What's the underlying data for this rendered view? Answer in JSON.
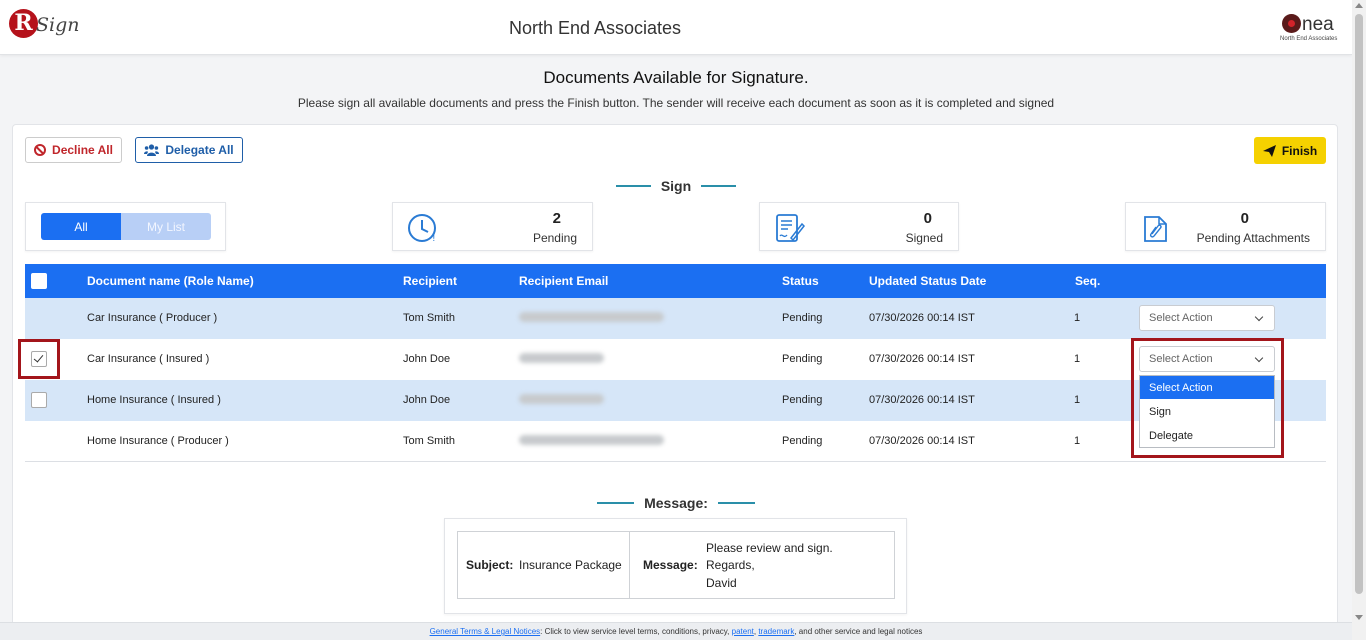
{
  "brand": {
    "logo_letter": "R",
    "logo_text": "Sign"
  },
  "header": {
    "company_name": "North End Associates",
    "partner_logo_word": "nea",
    "partner_logo_sub": "North End Associates"
  },
  "page": {
    "title": "Documents Available for Signature.",
    "subtitle": "Please sign all available documents and press the Finish button. The sender will receive each document as soon as it is completed and signed"
  },
  "toolbar": {
    "decline_label": "Decline All",
    "delegate_label": "Delegate All",
    "finish_label": "Finish"
  },
  "sign_section": {
    "label": "Sign"
  },
  "filter": {
    "all_label": "All",
    "mylist_label": "My List"
  },
  "stats": [
    {
      "value": "2",
      "label": "Pending",
      "icon": "clock-icon"
    },
    {
      "value": "0",
      "label": "Signed",
      "icon": "signed-document-icon"
    },
    {
      "value": "0",
      "label": "Pending Attachments",
      "icon": "attachment-icon"
    }
  ],
  "table": {
    "columns": [
      "Document name (Role Name)",
      "Recipient",
      "Recipient Email",
      "Status",
      "Updated Status Date",
      "Seq."
    ],
    "rows": [
      {
        "document": "Car Insurance ( Producer )",
        "recipient": "Tom Smith",
        "status": "Pending",
        "date": "07/30/2026 00:14 IST",
        "seq": "1",
        "action": "Select Action"
      },
      {
        "document": "Car Insurance ( Insured )",
        "recipient": "John Doe",
        "status": "Pending",
        "date": "07/30/2026 00:14 IST",
        "seq": "1",
        "action": "Select Action"
      },
      {
        "document": "Home Insurance ( Insured )",
        "recipient": "John Doe",
        "status": "Pending",
        "date": "07/30/2026 00:14 IST",
        "seq": "1",
        "action": "Select Action"
      },
      {
        "document": "Home Insurance ( Producer )",
        "recipient": "Tom Smith",
        "status": "Pending",
        "date": "07/30/2026 00:14 IST",
        "seq": "1",
        "action": "Select Action"
      }
    ]
  },
  "dropdown": {
    "options": [
      "Select Action",
      "Sign",
      "Delegate"
    ]
  },
  "message": {
    "heading": "Message:",
    "subject_label": "Subject:",
    "subject_value": "Insurance Package",
    "message_label": "Message:",
    "message_lines": [
      "Please review and sign.",
      "Regards,",
      "David"
    ]
  },
  "footer": {
    "link1": "General Terms & Legal Notices",
    "text1": ": Click to view service level terms, conditions, privacy, ",
    "link2": "patent",
    "text2": ", ",
    "link3": "trademark",
    "text3": ", and other service and legal notices"
  },
  "colors": {
    "primary": "#1b6ff2",
    "alt_row": "#d6e6f8",
    "finish": "#f5d100",
    "decline": "#c0262b",
    "highlight": "#a3151b"
  }
}
